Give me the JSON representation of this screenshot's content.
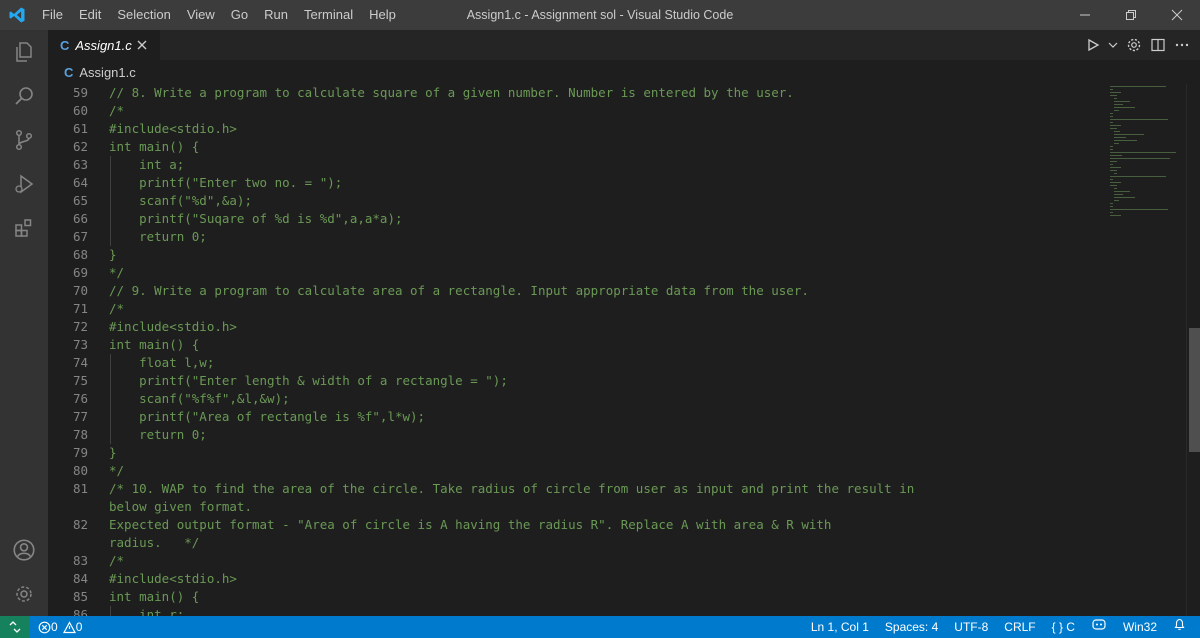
{
  "menu": [
    "File",
    "Edit",
    "Selection",
    "View",
    "Go",
    "Run",
    "Terminal",
    "Help"
  ],
  "window_title": "Assign1.c - Assignment sol - Visual Studio Code",
  "tab": {
    "icon_text": "C",
    "label": "Assign1.c"
  },
  "breadcrumb": {
    "icon_text": "C",
    "label": "Assign1.c"
  },
  "code_lines": [
    {
      "n": "59",
      "text": "// 8. Write a program to calculate square of a given number. Number is entered by the user."
    },
    {
      "n": "60",
      "text": "/*"
    },
    {
      "n": "61",
      "text": "#include<stdio.h>"
    },
    {
      "n": "62",
      "text": "int main() {"
    },
    {
      "n": "63",
      "text": "    int a;"
    },
    {
      "n": "64",
      "text": "    printf(\"Enter two no. = \");"
    },
    {
      "n": "65",
      "text": "    scanf(\"%d\",&a);"
    },
    {
      "n": "66",
      "text": "    printf(\"Suqare of %d is %d\",a,a*a);"
    },
    {
      "n": "67",
      "text": "    return 0;"
    },
    {
      "n": "68",
      "text": "}"
    },
    {
      "n": "69",
      "text": "*/"
    },
    {
      "n": "70",
      "text": "// 9. Write a program to calculate area of a rectangle. Input appropriate data from the user."
    },
    {
      "n": "71",
      "text": "/*"
    },
    {
      "n": "72",
      "text": "#include<stdio.h>"
    },
    {
      "n": "73",
      "text": "int main() {"
    },
    {
      "n": "74",
      "text": "    float l,w;"
    },
    {
      "n": "75",
      "text": "    printf(\"Enter length & width of a rectangle = \");"
    },
    {
      "n": "76",
      "text": "    scanf(\"%f%f\",&l,&w);"
    },
    {
      "n": "77",
      "text": "    printf(\"Area of rectangle is %f\",l*w);"
    },
    {
      "n": "78",
      "text": "    return 0;"
    },
    {
      "n": "79",
      "text": "}"
    },
    {
      "n": "80",
      "text": "*/"
    },
    {
      "n": "81",
      "text": "/* 10. WAP to find the area of the circle. Take radius of circle from user as input and print the result in"
    },
    {
      "n": "",
      "text": "below given format."
    },
    {
      "n": "82",
      "text": "Expected output format - \"Area of circle is A having the radius R\". Replace A with area & R with"
    },
    {
      "n": "",
      "text": "radius.   */"
    },
    {
      "n": "83",
      "text": "/*"
    },
    {
      "n": "84",
      "text": "#include<stdio.h>"
    },
    {
      "n": "85",
      "text": "int main() {"
    },
    {
      "n": "86",
      "text": "    int r;"
    }
  ],
  "status": {
    "errors": "0",
    "warnings": "0",
    "cursor": "Ln 1, Col 1",
    "spaces": "Spaces: 4",
    "encoding": "UTF-8",
    "eol": "CRLF",
    "language": "{ } C",
    "platform": "Win32"
  },
  "colors": {
    "comment": "#6a9955",
    "accent": "#007acc",
    "titlebar": "#3c3c3c",
    "activitybar": "#333333",
    "editor_bg": "#1e1e1e",
    "line_number": "#858585"
  },
  "icons": {
    "app": "vscode-logo-icon",
    "activity": [
      "explorer-icon",
      "search-icon",
      "source-control-icon",
      "run-debug-icon",
      "extensions-icon",
      "account-icon",
      "settings-gear-icon"
    ]
  }
}
